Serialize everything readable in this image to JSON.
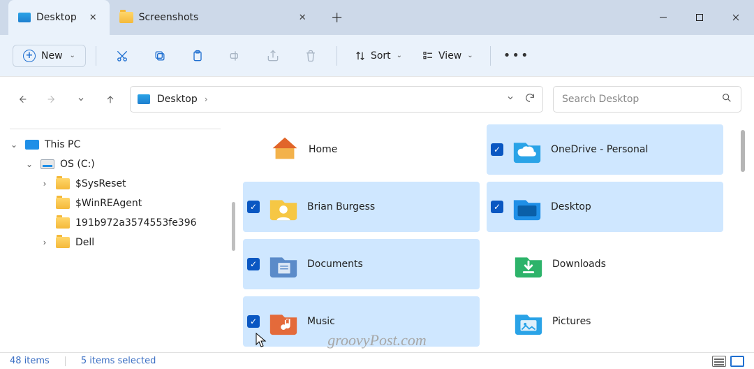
{
  "window": {
    "minimize_tooltip": "Minimize",
    "maximize_tooltip": "Maximize",
    "close_tooltip": "Close"
  },
  "tabs": [
    {
      "label": "Desktop",
      "icon": "desktop-folder",
      "active": true
    },
    {
      "label": "Screenshots",
      "icon": "folder",
      "active": false
    }
  ],
  "toolbar": {
    "new_label": "New",
    "sort_label": "Sort",
    "view_label": "View"
  },
  "addressbar": {
    "crumbs": [
      "Desktop"
    ]
  },
  "search": {
    "placeholder": "Search Desktop"
  },
  "tree": {
    "items": [
      {
        "label": "This PC",
        "icon": "pc",
        "depth": 0,
        "expander": "down"
      },
      {
        "label": "OS (C:)",
        "icon": "drive",
        "depth": 1,
        "expander": "down"
      },
      {
        "label": "$SysReset",
        "icon": "folder",
        "depth": 2,
        "expander": "right"
      },
      {
        "label": "$WinREAgent",
        "icon": "folder",
        "depth": 2,
        "expander": "none"
      },
      {
        "label": "191b972a3574553fe396",
        "icon": "folder",
        "depth": 2,
        "expander": "none"
      },
      {
        "label": "Dell",
        "icon": "folder",
        "depth": 2,
        "expander": "right"
      }
    ]
  },
  "content": {
    "col1": [
      {
        "label": "Home",
        "icon": "home",
        "selected": false
      },
      {
        "label": "Brian Burgess",
        "icon": "user-folder",
        "selected": true
      },
      {
        "label": "Documents",
        "icon": "documents",
        "selected": true
      },
      {
        "label": "Music",
        "icon": "music",
        "selected": true
      }
    ],
    "col2": [
      {
        "label": "OneDrive - Personal",
        "icon": "onedrive",
        "selected": true
      },
      {
        "label": "Desktop",
        "icon": "desktop-folder-lg",
        "selected": true
      },
      {
        "label": "Downloads",
        "icon": "downloads",
        "selected": false
      },
      {
        "label": "Pictures",
        "icon": "pictures",
        "selected": false
      }
    ]
  },
  "statusbar": {
    "count_text": "48 items",
    "selected_text": "5 items selected"
  },
  "watermark": "groovyPost.com"
}
